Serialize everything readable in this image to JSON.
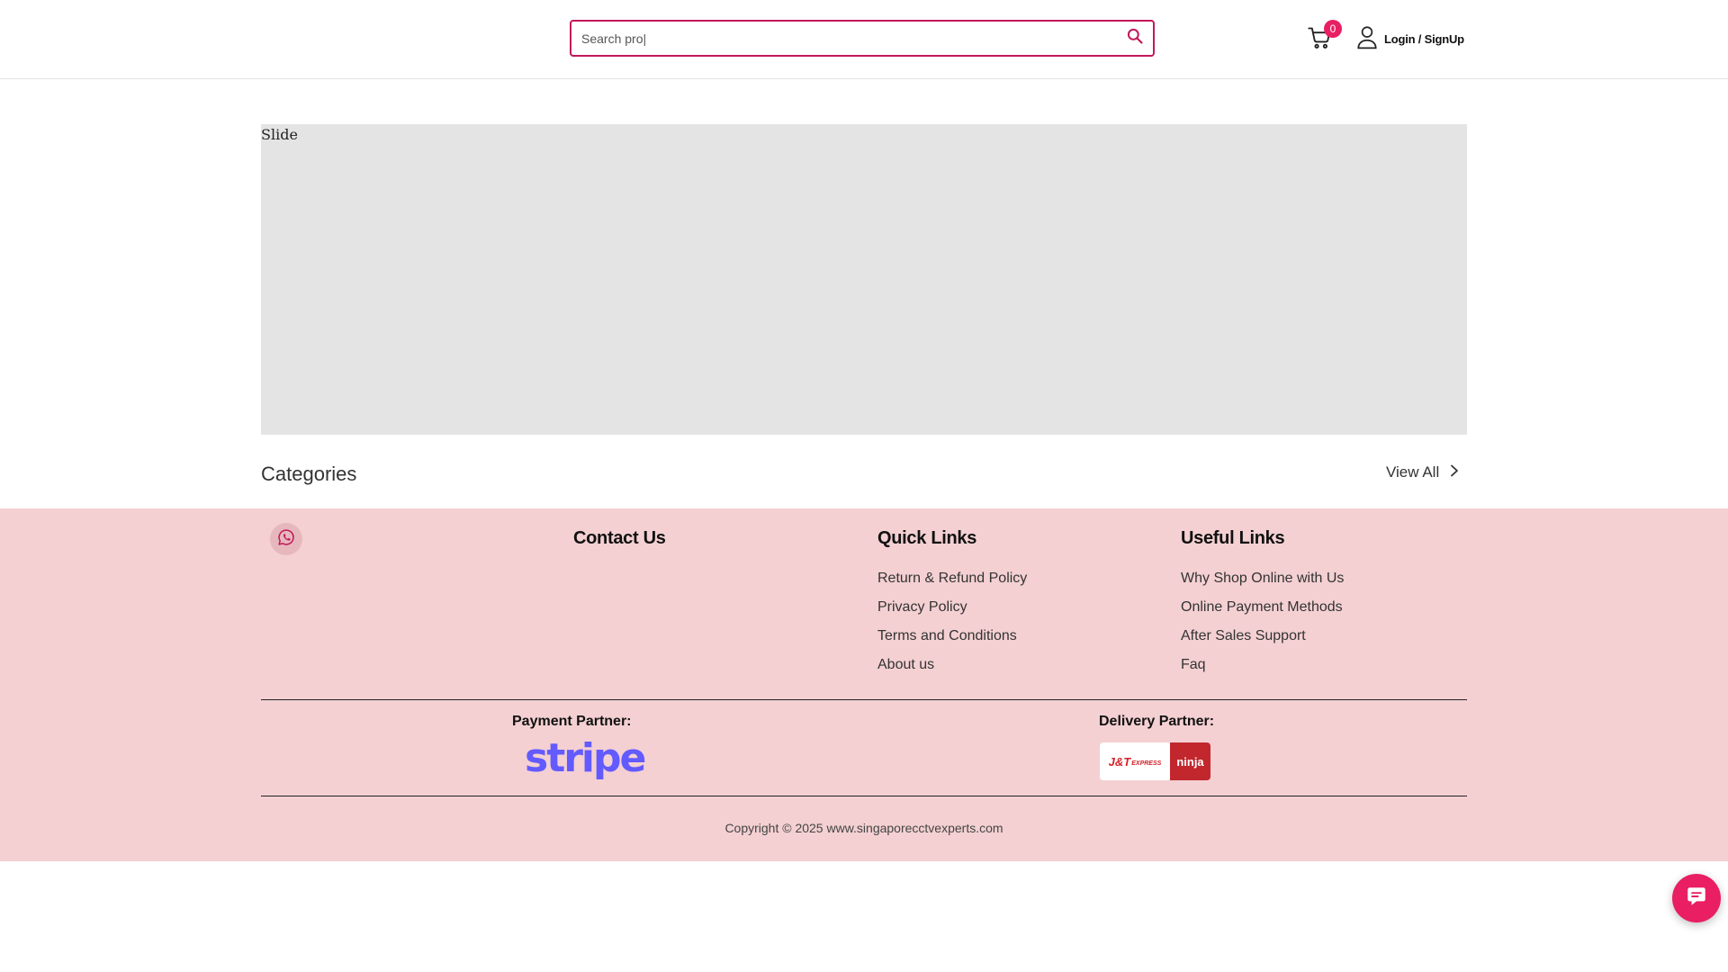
{
  "header": {
    "search": {
      "value": "",
      "placeholder": "Search pro|"
    },
    "cart_count": "0",
    "login_label": "Login / SignUp"
  },
  "slider": {
    "image_alt": "Slide"
  },
  "categories": {
    "title": "Categories",
    "view_all_label": "View All"
  },
  "footer": {
    "contact_title": "Contact Us",
    "quick_links": {
      "title": "Quick Links",
      "items": [
        "Return & Refund Policy",
        "Privacy Policy",
        "Terms and Conditions",
        "About us"
      ]
    },
    "useful_links": {
      "title": "Useful Links",
      "items": [
        "Why Shop Online with Us",
        "Online Payment Methods",
        "After Sales Support",
        "Faq"
      ]
    },
    "payment_partner": {
      "title": "Payment Partner:",
      "logo_text": "stripe"
    },
    "delivery_partner": {
      "title": "Delivery Partner:",
      "logo_jt": "J&T",
      "logo_jt_small": "EXPRESS",
      "logo_ninja": "ninja"
    },
    "copyright": "Copyright © 2025 www.singaporecctvexperts.com"
  },
  "icons": {
    "search": "search-icon",
    "cart": "cart-icon",
    "user": "user-icon",
    "chevron": "chevron-right-icon",
    "whatsapp": "whatsapp-icon",
    "chat": "chat-icon"
  },
  "colors": {
    "accent": "#e91e63",
    "search_border": "#c2185b",
    "footer_bg": "#f4d0d2",
    "slider_bg": "#e4e4e4",
    "stripe": "#635bff",
    "ninja": "#c1272d"
  }
}
